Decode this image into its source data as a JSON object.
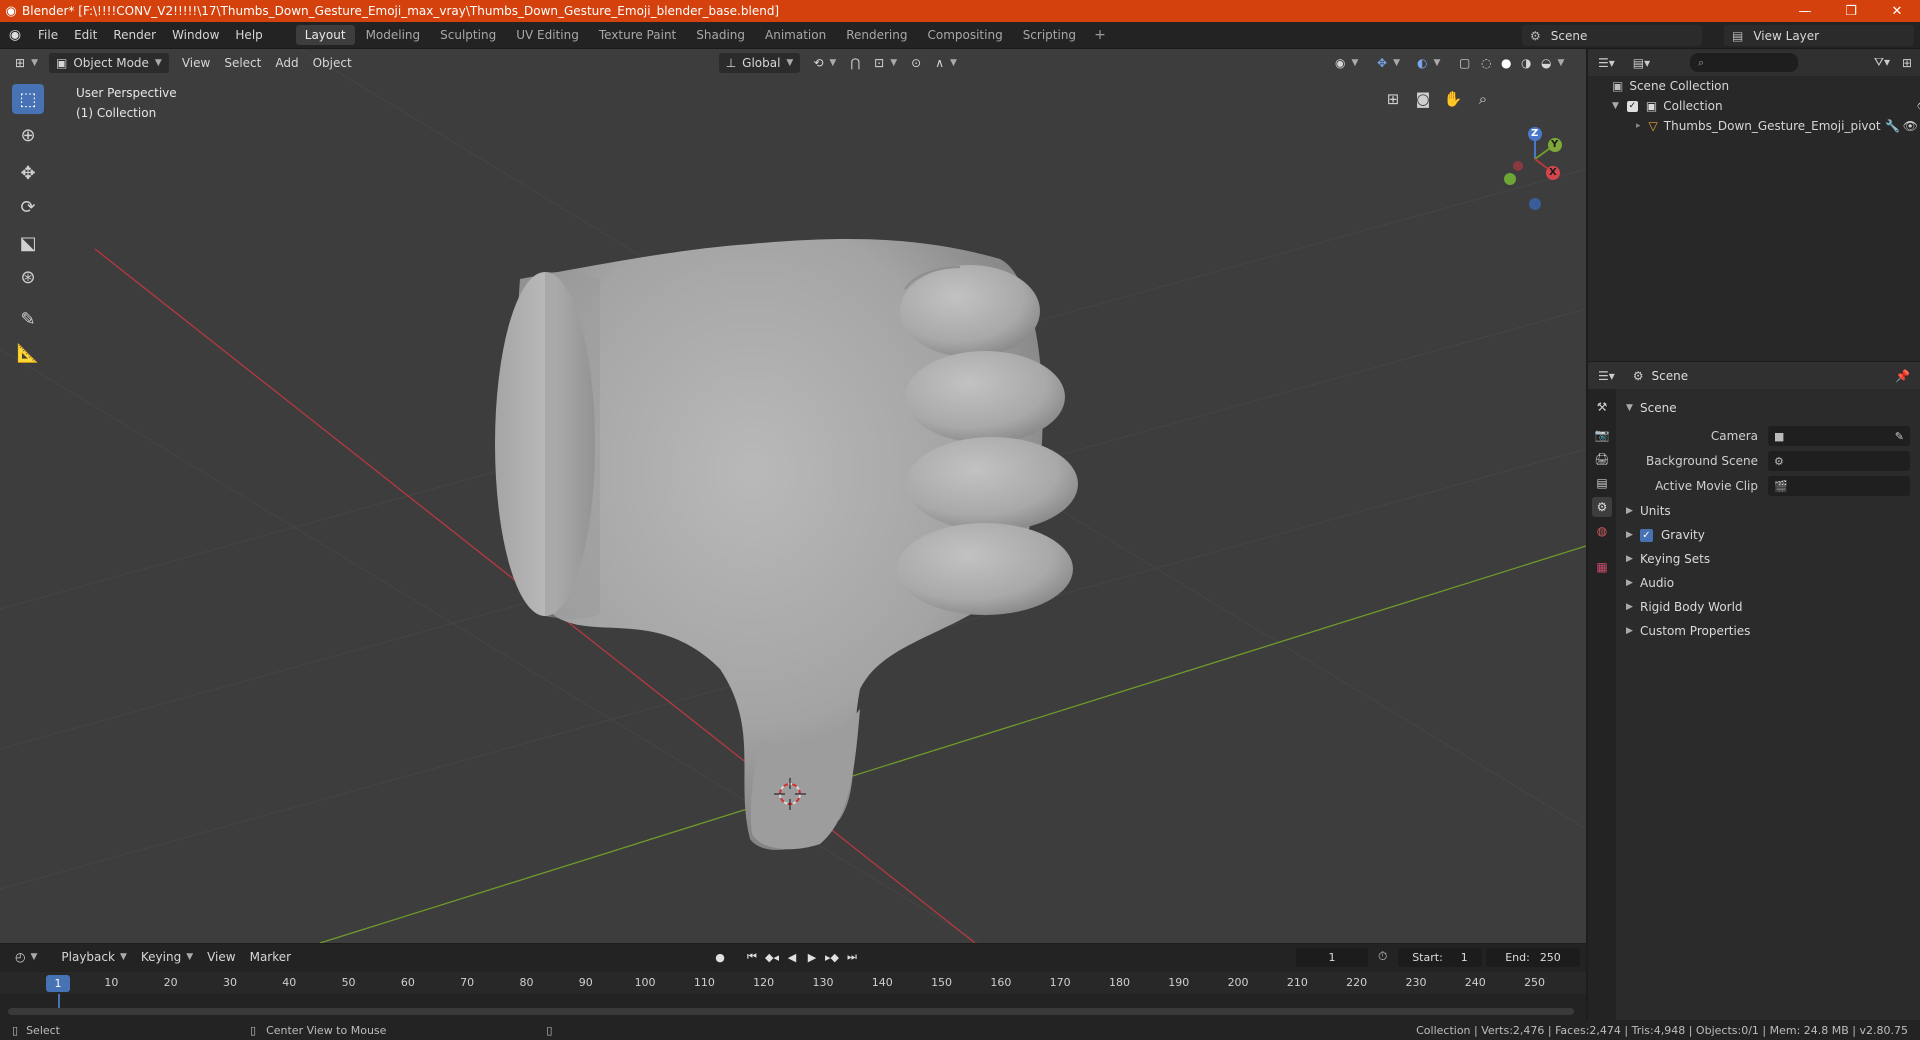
{
  "window": {
    "title": "Blender* [F:\\!!!!CONV_V2!!!!!\\17\\Thumbs_Down_Gesture_Emoji_max_vray\\Thumbs_Down_Gesture_Emoji_blender_base.blend]",
    "minimize": "—",
    "restore": "❐",
    "close": "✕"
  },
  "menu": [
    "File",
    "Edit",
    "Render",
    "Window",
    "Help"
  ],
  "workspaces": [
    "Layout",
    "Modeling",
    "Sculpting",
    "UV Editing",
    "Texture Paint",
    "Shading",
    "Animation",
    "Rendering",
    "Compositing",
    "Scripting"
  ],
  "active_workspace": "Layout",
  "scene_name": "Scene",
  "view_layer": "View Layer",
  "viewport": {
    "mode": "Object Mode",
    "menus": [
      "View",
      "Select",
      "Add",
      "Object"
    ],
    "transform_orientation": "Global",
    "perspective_label": "User Perspective",
    "collection_label": "(1) Collection",
    "axes": {
      "z": "Z",
      "y": "Y",
      "x": "X"
    }
  },
  "outliner": {
    "search_placeholder": "",
    "root": "Scene Collection",
    "collection": "Collection",
    "object": "Thumbs_Down_Gesture_Emoji_pivot"
  },
  "properties": {
    "header": "Scene",
    "panel_title": "Scene",
    "fields": [
      {
        "label": "Camera",
        "value": ""
      },
      {
        "label": "Background Scene",
        "value": ""
      },
      {
        "label": "Active Movie Clip",
        "value": ""
      }
    ],
    "sections": [
      "Units",
      "Gravity",
      "Keying Sets",
      "Audio",
      "Rigid Body World",
      "Custom Properties"
    ]
  },
  "timeline": {
    "menus": [
      "Playback",
      "Keying",
      "View",
      "Marker"
    ],
    "current_frame": "1",
    "start_label": "Start:",
    "start": "1",
    "end_label": "End:",
    "end": "250",
    "ticks": [
      "1",
      "10",
      "20",
      "30",
      "40",
      "50",
      "60",
      "70",
      "80",
      "90",
      "100",
      "110",
      "120",
      "130",
      "140",
      "150",
      "160",
      "170",
      "180",
      "190",
      "200",
      "210",
      "220",
      "230",
      "240",
      "250"
    ]
  },
  "statusbar": {
    "left": "Select",
    "middle": "Center View to Mouse",
    "right": "Collection | Verts:2,476 | Faces:2,474 | Tris:4,948 | Objects:0/1 | Mem: 24.8 MB | v2.80.75"
  },
  "colors": {
    "titlebar": "#d4410c",
    "accent": "#4772b3",
    "viewport_bg": "#3d3d3d",
    "x_axis": "#b5393f",
    "y_axis": "#6f9b2a"
  }
}
